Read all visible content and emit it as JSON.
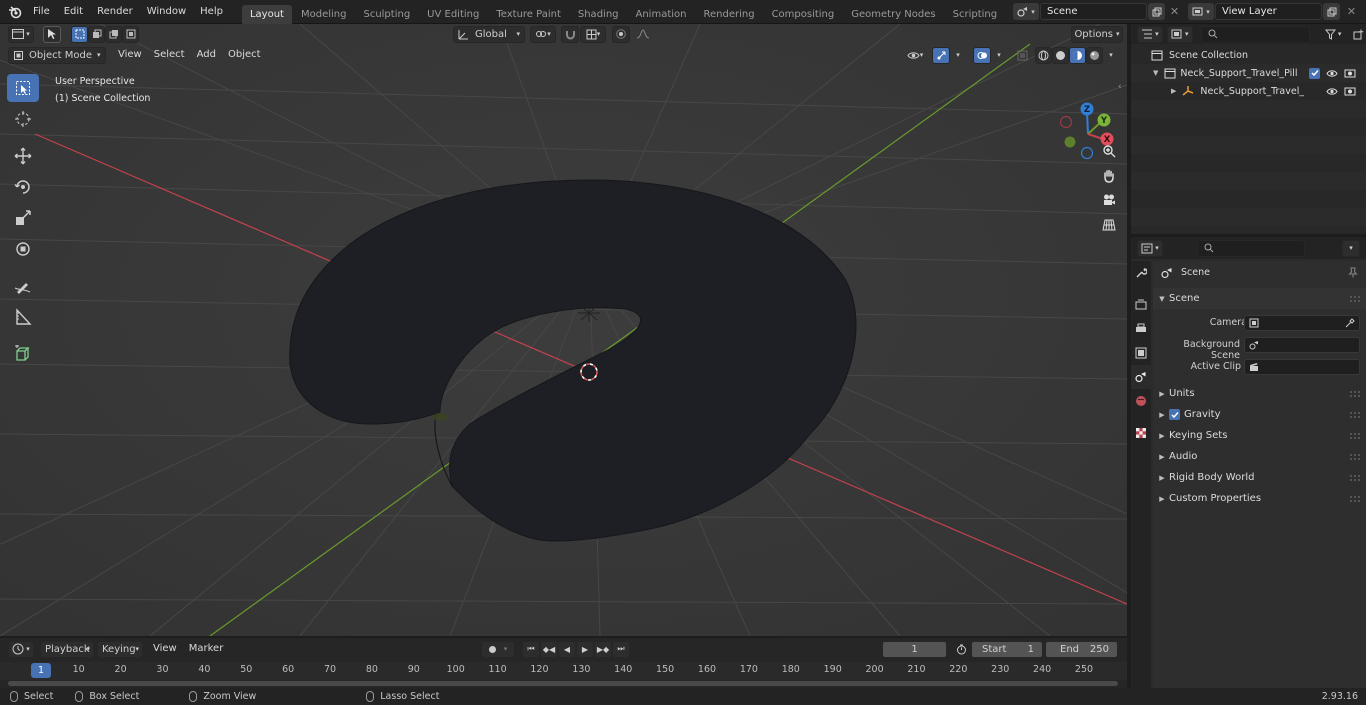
{
  "menubar": {
    "items": [
      "File",
      "Edit",
      "Render",
      "Window",
      "Help"
    ]
  },
  "workspaces": {
    "tabs": [
      "Layout",
      "Modeling",
      "Sculpting",
      "UV Editing",
      "Texture Paint",
      "Shading",
      "Animation",
      "Rendering",
      "Compositing",
      "Geometry Nodes",
      "Scripting"
    ],
    "active": "Layout"
  },
  "scene_selector": {
    "value": "Scene"
  },
  "view_layer_selector": {
    "value": "View Layer"
  },
  "viewport": {
    "transform_orientation": "Global",
    "options_label": "Options",
    "mode": "Object Mode",
    "menus": [
      "View",
      "Select",
      "Add",
      "Object"
    ],
    "overlay_line1": "User Perspective",
    "overlay_line2": "(1) Scene Collection",
    "gizmo_axes": {
      "z": "Z",
      "y": "Y",
      "x": "X"
    }
  },
  "outliner": {
    "root": "Scene Collection",
    "collection": "Neck_Support_Travel_Pillow_l",
    "object": "Neck_Support_Travel_Pill"
  },
  "properties": {
    "header_title": "Scene",
    "section": "Scene",
    "fields": {
      "camera_label": "Camera",
      "background_label": "Background Scene",
      "clip_label": "Active Clip"
    },
    "panels": [
      "Units",
      "Gravity",
      "Keying Sets",
      "Audio",
      "Rigid Body World",
      "Custom Properties"
    ],
    "gravity_checked": true
  },
  "timeline": {
    "menus": [
      "Playback",
      "Keying",
      "View",
      "Marker"
    ],
    "current_frame": "1",
    "start_label": "Start",
    "start_value": "1",
    "end_label": "End",
    "end_value": "250",
    "ruler_ticks": [
      "1",
      "10",
      "20",
      "30",
      "40",
      "50",
      "60",
      "70",
      "80",
      "90",
      "100",
      "110",
      "120",
      "130",
      "140",
      "150",
      "160",
      "170",
      "180",
      "190",
      "200",
      "210",
      "220",
      "230",
      "240",
      "250"
    ]
  },
  "statusbar": {
    "select": "Select",
    "box_select": "Box Select",
    "zoom_view": "Zoom View",
    "lasso_select": "Lasso Select",
    "version": "2.93.16"
  },
  "colors": {
    "accent": "#4772b3",
    "x_axis": "#c4424d",
    "y_axis": "#6a9a2a",
    "z_axis": "#2f7fd6"
  }
}
